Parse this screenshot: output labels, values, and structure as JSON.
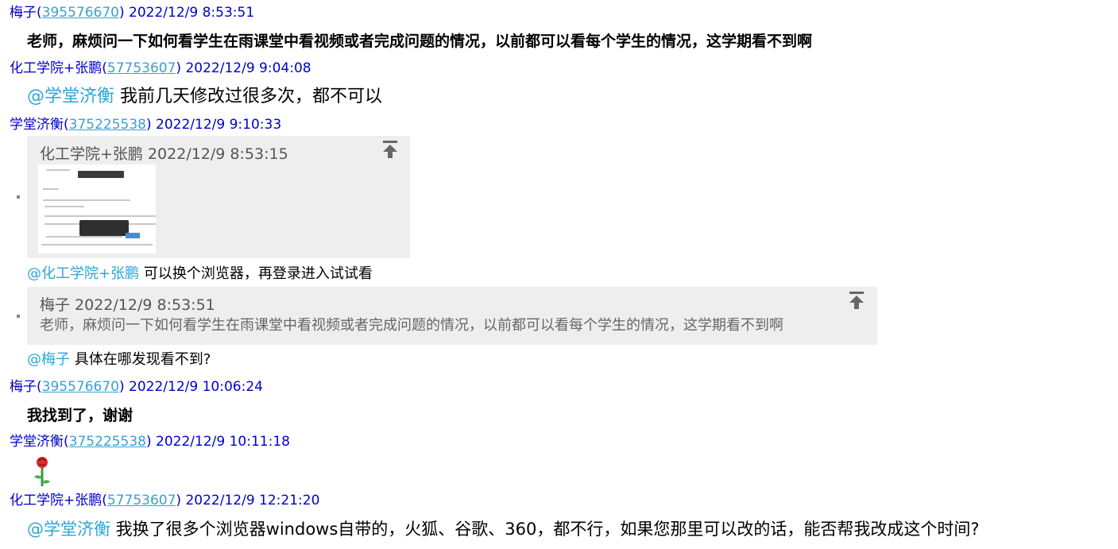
{
  "messages": [
    {
      "sender": "梅子",
      "qq": "395576670",
      "time": "2022/12/9 8:53:51",
      "text": "老师，麻烦问一下如何看学生在雨课堂中看视频或者完成问题的情况，以前都可以看每个学生的情况，这学期看不到啊"
    },
    {
      "sender": "化工学院+张鹏",
      "qq": "57753607",
      "time": "2022/12/9 9:04:08",
      "mention": "@学堂济衡",
      "text": " 我前几天修改过很多次，都不可以"
    },
    {
      "sender": "学堂济衡",
      "qq": "375225538",
      "time": "2022/12/9 9:10:33",
      "quote1": {
        "head": "化工学院+张鹏  2022/12/9 8:53:15"
      },
      "reply1": {
        "mention": "@化工学院+张鹏",
        "text": " 可以换个浏览器，再登录进入试试看"
      },
      "quote2": {
        "head": "梅子  2022/12/9 8:53:51",
        "body": "老师，麻烦问一下如何看学生在雨课堂中看视频或者完成问题的情况，以前都可以看每个学生的情况，这学期看不到啊"
      },
      "reply2": {
        "mention": "@梅子",
        "text": " 具体在哪发现看不到?"
      }
    },
    {
      "sender": "梅子",
      "qq": "395576670",
      "time": "2022/12/9 10:06:24",
      "text": "我找到了，谢谢"
    },
    {
      "sender": "学堂济衡",
      "qq": "375225538",
      "time": "2022/12/9 10:11:18",
      "emoji": "rose-emoji"
    },
    {
      "sender": "化工学院+张鹏",
      "qq": "57753607",
      "time": "2022/12/9 12:21:20",
      "mention": "@学堂济衡",
      "text": " 我换了很多个浏览器windows自带的，火狐、谷歌、360，都不行，如果您那里可以改的话，能否帮我改成这个时间?"
    }
  ],
  "colors": {
    "header": "#0000cc",
    "qq_link": "#3aa0d0",
    "mention": "#2ca6d8",
    "quote_bg": "#eeeeee"
  }
}
